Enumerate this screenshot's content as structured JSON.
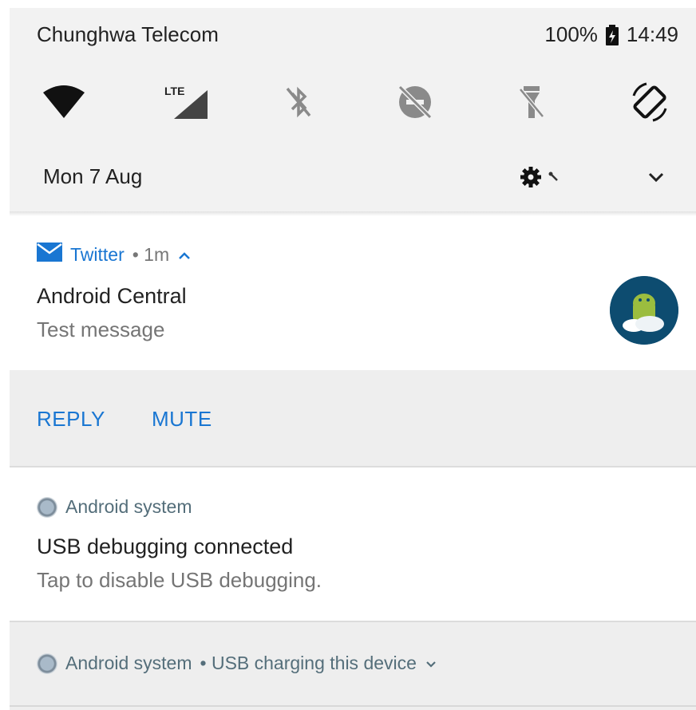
{
  "status_bar": {
    "carrier": "Chunghwa Telecom",
    "battery": "100%",
    "time": "14:49"
  },
  "quick_settings": {
    "tiles": [
      {
        "name": "wifi",
        "icon": "wifi-icon"
      },
      {
        "name": "mobile-data",
        "icon": "lte-signal-icon",
        "label": "LTE"
      },
      {
        "name": "bluetooth",
        "icon": "bluetooth-off-icon"
      },
      {
        "name": "do-not-disturb",
        "icon": "dnd-off-icon"
      },
      {
        "name": "flashlight",
        "icon": "flashlight-off-icon"
      },
      {
        "name": "auto-rotate",
        "icon": "auto-rotate-icon"
      }
    ],
    "date": "Mon 7 Aug"
  },
  "notifications": [
    {
      "app": "Twitter",
      "meta": "• 1m",
      "title": "Android Central",
      "text": "Test message",
      "actions": [
        "REPLY",
        "MUTE"
      ]
    },
    {
      "app": "Android system",
      "title": "USB debugging connected",
      "text": "Tap to disable USB debugging."
    },
    {
      "app": "Android system",
      "meta": "• USB charging this device"
    }
  ],
  "colors": {
    "accent": "#1976d2",
    "panel": "#f2f2f2",
    "action_bar": "#eeeeee",
    "avatar_bg": "#0d4c70"
  }
}
